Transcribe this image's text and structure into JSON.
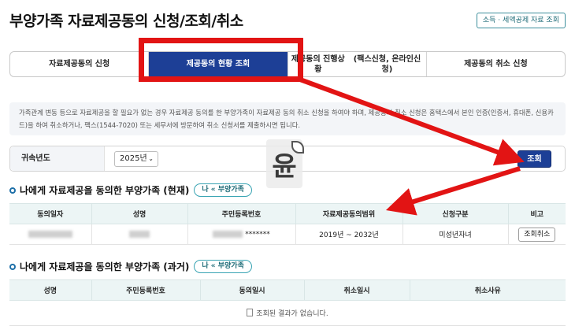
{
  "page": {
    "title": "부양가족 자료제공동의 신청/조회/취소",
    "top_link": "소득 · 세액공제 자료 조회"
  },
  "tabs": [
    {
      "label": "자료제공동의 신청",
      "active": false
    },
    {
      "label": "제공동의 현황 조회",
      "active": true
    },
    {
      "label": "제공동의 진행상황\n(팩스신청, 온라인신청)",
      "active": false
    },
    {
      "label": "제공동의 취소 신청",
      "active": false
    }
  ],
  "notice": {
    "text": "가족관계 변동 등으로 자료제공을 할 필요가 없는 경우 자료제공 동의를 한 부양가족이 자료제공 동의 취소 신청을 하여야 하며, 제공동의 취소 신청은 홈택스에서 본인 인증(인증서, 휴대폰, 신용카드)을 하여 취소하거나, 팩스(1544-7020) 또는 세무서에 방문하여 취소 신청서를 제출하시면 됩니다."
  },
  "search": {
    "label": "귀속년도",
    "year": "2025년",
    "button": "조회"
  },
  "watermark": {
    "glyph": "윤"
  },
  "current_section": {
    "title": "나에게 자료제공을 동의한 부양가족 (현재)",
    "pill": "나 « 부양가족",
    "columns": [
      "동의일자",
      "성명",
      "주민등록번호",
      "자료제공동의범위",
      "신청구분",
      "비고"
    ],
    "rows": [
      {
        "ssn_suffix": "*******",
        "range": "2019년 ~ 2032년",
        "type": "미성년자녀",
        "action": "조회취소"
      }
    ]
  },
  "past_section": {
    "title": "나에게 자료제공을 동의한 부양가족 (과거)",
    "pill": "나 « 부양가족",
    "columns": [
      "성명",
      "주민등록번호",
      "동의일시",
      "취소일시",
      "취소사유"
    ],
    "empty_message": "조회된 결과가 없습니다."
  },
  "colors": {
    "primary": "#1d3f96",
    "highlight": "#e21414",
    "teal": "#39a4b3"
  }
}
